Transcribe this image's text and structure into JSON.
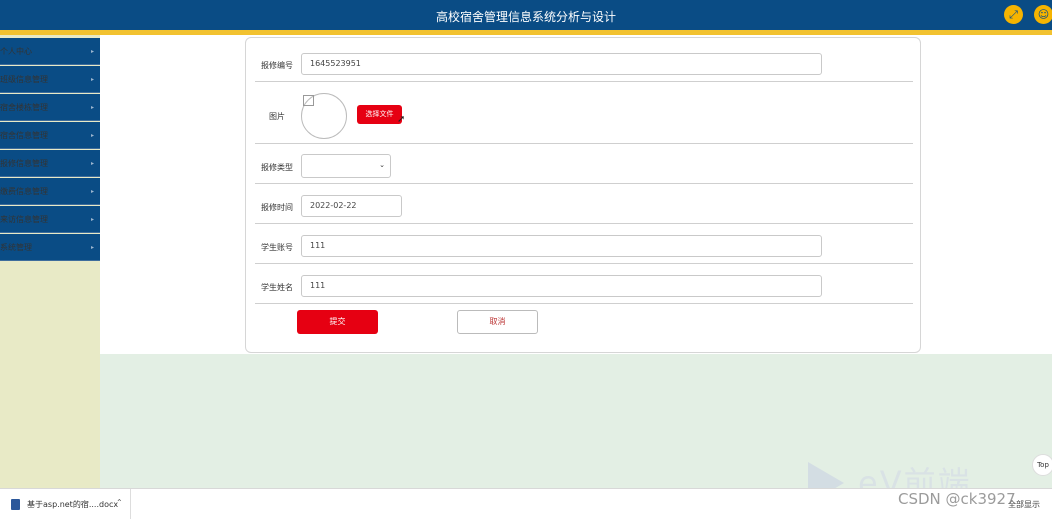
{
  "header": {
    "title": "高校宿舍管理信息系统分析与设计"
  },
  "sidebar": {
    "items": [
      {
        "label": "个人中心"
      },
      {
        "label": "班级信息管理"
      },
      {
        "label": "宿舍楼栋管理"
      },
      {
        "label": "宿舍信息管理"
      },
      {
        "label": "报修信息管理"
      },
      {
        "label": "缴费信息管理"
      },
      {
        "label": "来访信息管理"
      },
      {
        "label": "系统管理"
      }
    ]
  },
  "form": {
    "repair_no": {
      "label": "报修编号",
      "value": "1645523951"
    },
    "picture": {
      "label": "图片",
      "choose_label": "选择文件"
    },
    "repair_type": {
      "label": "报修类型",
      "value": ""
    },
    "repair_time": {
      "label": "报修时间",
      "value": "2022-02-22"
    },
    "student_account": {
      "label": "学生账号",
      "value": "111"
    },
    "student_name": {
      "label": "学生姓名",
      "value": "111"
    },
    "submit_label": "提交",
    "cancel_label": "取消"
  },
  "top_button": {
    "label": "Top"
  },
  "download_bar": {
    "file_name": "基于asp.net的宿....docx",
    "show_all": "全部显示"
  },
  "watermark": {
    "text": "CSDN @ck3927",
    "logo_text": "eV前端"
  },
  "colors": {
    "primary": "#0a4c85",
    "accent": "#f2c230",
    "danger": "#e60012",
    "sidebar_bg": "#e8eac6",
    "page_bg": "#e3efe4"
  }
}
